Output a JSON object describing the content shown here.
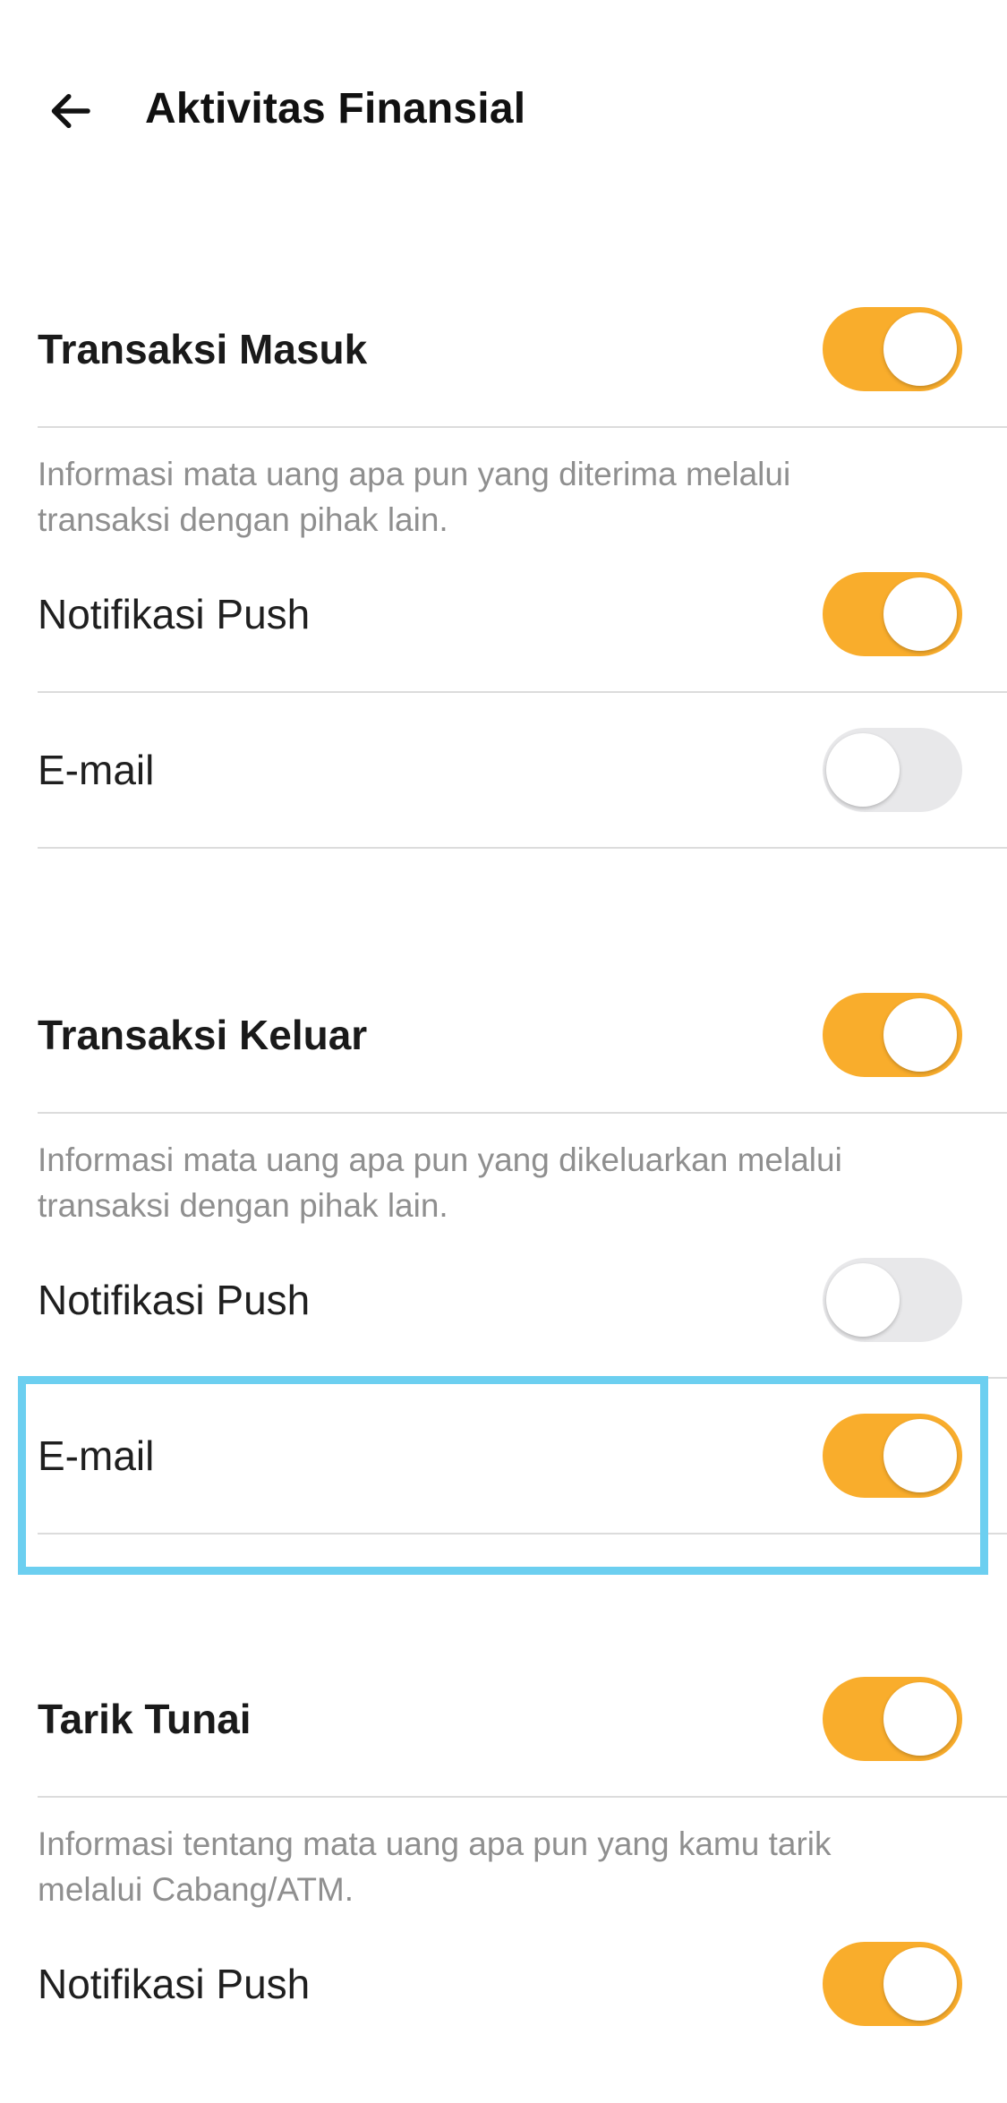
{
  "header": {
    "back_icon": "arrow-left-icon",
    "title": "Aktivitas Finansial"
  },
  "sections": [
    {
      "title": "Transaksi Masuk",
      "enabled": true,
      "description": "Informasi mata uang apa pun yang diterima melalui transaksi dengan pihak lain.",
      "options": [
        {
          "label": "Notifikasi Push",
          "enabled": true
        },
        {
          "label": "E-mail",
          "enabled": false
        }
      ]
    },
    {
      "title": "Transaksi Keluar",
      "enabled": true,
      "description": "Informasi mata uang apa pun yang dikeluarkan melalui transaksi dengan pihak lain.",
      "options": [
        {
          "label": "Notifikasi Push",
          "enabled": false
        },
        {
          "label": "E-mail",
          "enabled": true
        }
      ]
    },
    {
      "title": "Tarik Tunai",
      "enabled": true,
      "description": "Informasi tentang mata uang apa pun yang kamu tarik melalui Cabang/ATM.",
      "options": [
        {
          "label": "Notifikasi Push",
          "enabled": true
        }
      ]
    }
  ],
  "colors": {
    "toggle_on": "#f9ad2c",
    "toggle_off": "#e8e8ea",
    "highlight": "#6ccff0"
  }
}
